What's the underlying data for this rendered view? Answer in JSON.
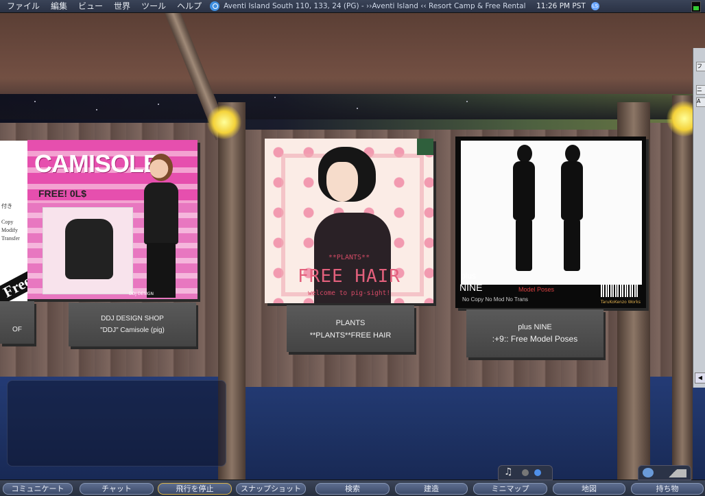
{
  "menubar": {
    "items": [
      "ファイル",
      "編集",
      "ビュー",
      "世界",
      "ツール",
      "ヘルプ"
    ],
    "location": "Aventi Island South 110, 133, 24 (PG) - ››Aventi Island ‹‹ Resort Camp & Free Rental S",
    "clock": "11:26 PM PST",
    "ls_icon": "LS"
  },
  "posters": {
    "camisole": {
      "title": "CAMISOLE",
      "price": "FREE!  0L$",
      "brand": "DDJ DESIGN"
    },
    "plants": {
      "subtitle": "**PLANTS**",
      "title": "FREE HAIR",
      "tagline": "welcome to pig-sight!"
    },
    "poses": {
      "plus": "plus",
      "nine": "NINE",
      "model": "Model Poses",
      "perm": "No Copy No Mod No Trans",
      "brand": "TaruKoKenzo Works"
    },
    "left_cut": {
      "lines": [
        "付き",
        "Copy",
        "Modify",
        "Transfer"
      ],
      "free": "Free"
    }
  },
  "signs": {
    "of": "OF",
    "ddj": {
      "line1": "DDJ DESIGN SHOP",
      "line2": "\"DDJ\" Camisole (pig)"
    },
    "plants": {
      "line1": "PLANTS",
      "line2": "**PLANTS**FREE HAIR"
    },
    "nine": {
      "line1": "plus NINE",
      "line2": ":+9:: Free Model Poses"
    }
  },
  "bottombar": {
    "buttons": [
      "コミュニケート",
      "チャット",
      "飛行を停止",
      "スナップショット",
      "検索",
      "建造",
      "ミニマップ",
      "地図",
      "持ち物"
    ]
  },
  "mini_controls": {
    "note_icon": "♫"
  },
  "right_floater": {
    "tab1": "フ",
    "tab2": "ニ",
    "tab3": "A"
  },
  "colors": {
    "menubar": "#2f3849",
    "accent": "#3f8fe0",
    "active_border": "#d9b34a",
    "water": "#1f3467"
  }
}
